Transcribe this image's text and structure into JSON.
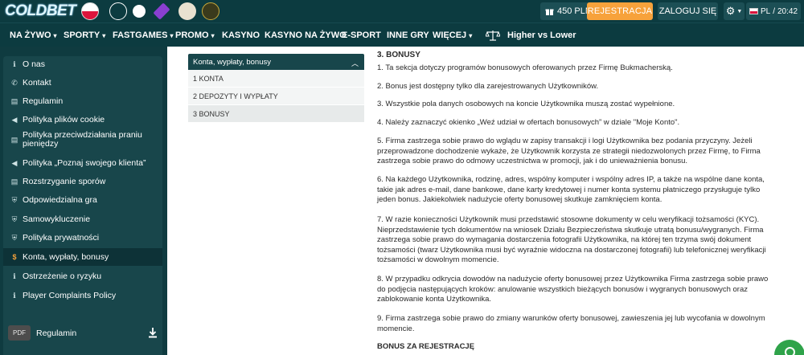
{
  "brand": {
    "logo": "COLDBET"
  },
  "header": {
    "balance": "450 PLN",
    "register_label": "REJESTRACJA",
    "login_label": "ZALOGUJ SIĘ",
    "language": "PL",
    "time": "20:42"
  },
  "nav": [
    {
      "label": "NA ŻYWO",
      "dropdown": true
    },
    {
      "label": "SPORTY",
      "dropdown": true
    },
    {
      "label": "FASTGAMES",
      "dropdown": true
    },
    {
      "label": "PROMO",
      "dropdown": true
    },
    {
      "label": "KASYNO",
      "dropdown": false
    },
    {
      "label": "KASYNO NA ŻYWO",
      "dropdown": false
    },
    {
      "label": "E-SPORT",
      "dropdown": false
    },
    {
      "label": "INNE GRY",
      "dropdown": false
    },
    {
      "label": "WIĘCEJ",
      "dropdown": true
    },
    {
      "label": "Higher vs Lower",
      "dropdown": false
    }
  ],
  "sidebar": {
    "items": [
      {
        "label": "O nas",
        "icon": "info-icon"
      },
      {
        "label": "Kontakt",
        "icon": "phone-icon"
      },
      {
        "label": "Regulamin",
        "icon": "document-icon"
      },
      {
        "label": "Polityka plików cookie",
        "icon": "megaphone-icon"
      },
      {
        "label": "Polityka przeciwdziałania praniu pieniędzy",
        "icon": "document-icon"
      },
      {
        "label": "Polityka „Poznaj swojego klienta”",
        "icon": "megaphone-icon"
      },
      {
        "label": "Rozstrzyganie sporów",
        "icon": "document-icon"
      },
      {
        "label": "Odpowiedzialna gra",
        "icon": "shield-check-icon"
      },
      {
        "label": "Samowykluczenie",
        "icon": "shield-icon"
      },
      {
        "label": "Polityka prywatności",
        "icon": "shield-icon"
      },
      {
        "label": "Konta, wypłaty, bonusy",
        "icon": "dollar-icon",
        "active": true
      },
      {
        "label": "Ostrzeżenie o ryzyku",
        "icon": "info-icon"
      },
      {
        "label": "Player Complaints Policy",
        "icon": "info-icon"
      }
    ],
    "pdf": {
      "badge": "PDF",
      "label": "Regulamin"
    }
  },
  "toc": {
    "title": "Konta, wypłaty, bonusy",
    "items": [
      "1 KONTA",
      "2 DEPOZYTY I WYPŁATY",
      "3 BONUSY"
    ],
    "active_index": 2
  },
  "content": {
    "section_title": "3. BONUSY",
    "paragraphs": [
      "1. Ta sekcja dotyczy programów bonusowych oferowanych przez Firmę Bukmacherską.",
      "2. Bonus jest dostępny tylko dla zarejestrowanych Użytkowników.",
      "3. Wszystkie pola danych osobowych na koncie Użytkownika muszą zostać wypełnione.",
      "4. Należy zaznaczyć okienko „Weź udział w ofertach bonusowych” w dziale \"Moje Konto\".",
      "5. Firma zastrzega sobie prawo do wglądu w zapisy transakcji i logi Użytkownika bez podania przyczyny. Jeżeli przeprowadzone dochodzenie wykaże, że Użytkownik korzysta ze strategii niedozwolonych przez Firmę, to Firma zastrzega sobie prawo do odmowy uczestnictwa w promocji, jak i do unieważnienia bonusu.",
      "6. Na każdego Użytkownika, rodzinę, adres, wspólny komputer i wspólny adres IP, a także na wspólne dane konta, takie jak adres e-mail, dane bankowe, dane karty kredytowej i numer konta systemu płatniczego przysługuje tylko jeden bonus. Jakiekolwiek nadużycie oferty bonusowej skutkuje zamknięciem konta.",
      "7. W razie konieczności Użytkownik musi przedstawić stosowne dokumenty w celu weryfikacji tożsamości (KYC). Nieprzedstawienie tych dokumentów na wniosek Działu Bezpieczeństwa skutkuje utratą bonusu/wygranych. Firma zastrzega sobie prawo do wymagania dostarczenia fotografii Użytkownika, na której ten trzyma swój dokument tożsamości (twarz Użytkownika musi być wyraźnie widoczna na dostarczonej fotografii) lub telefonicznej weryfikacji tożsamości w dowolnym momencie.",
      "8. W przypadku odkrycia dowodów na nadużycie oferty bonusowej przez Użytkownika Firma zastrzega sobie prawo do podjęcia następujących kroków: anulowanie wszystkich bieżących bonusów i wygranych bonusowych oraz zablokowanie konta Użytkownika.",
      "9. Firma zastrzega sobie prawo do zmiany warunków oferty bonusowej, zawieszenia jej lub wycofania w dowolnym momencie."
    ],
    "subheading": "BONUS ZA REJESTRACJĘ"
  },
  "colors": {
    "dark_teal": "#0c3b40",
    "panel_teal": "#18464b",
    "accent_orange": "#f7a23b",
    "chat_green": "#2fa34a"
  }
}
